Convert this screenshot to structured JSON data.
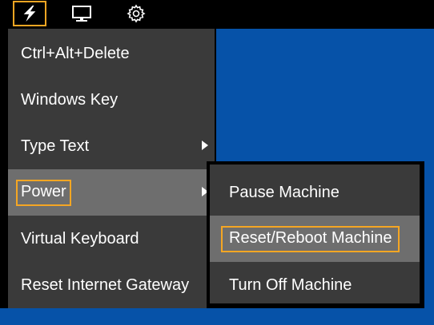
{
  "toolbar": {
    "power_icon": "lightning-bolt-icon",
    "monitor_icon": "monitor-icon",
    "settings_icon": "gear-icon"
  },
  "menu": {
    "items": [
      {
        "label": "Ctrl+Alt+Delete"
      },
      {
        "label": "Windows Key"
      },
      {
        "label": "Type Text"
      },
      {
        "label": "Power"
      },
      {
        "label": "Virtual Keyboard"
      },
      {
        "label": "Reset Internet Gateway"
      }
    ]
  },
  "submenu": {
    "items": [
      {
        "label": "Pause Machine"
      },
      {
        "label": "Reset/Reboot Machine"
      },
      {
        "label": "Turn Off Machine"
      }
    ]
  },
  "colors": {
    "highlight_border": "#f5a623",
    "menu_bg": "#3a3a3a",
    "hover_bg": "#6e6e6e",
    "desktop_bg": "#0652a8"
  }
}
